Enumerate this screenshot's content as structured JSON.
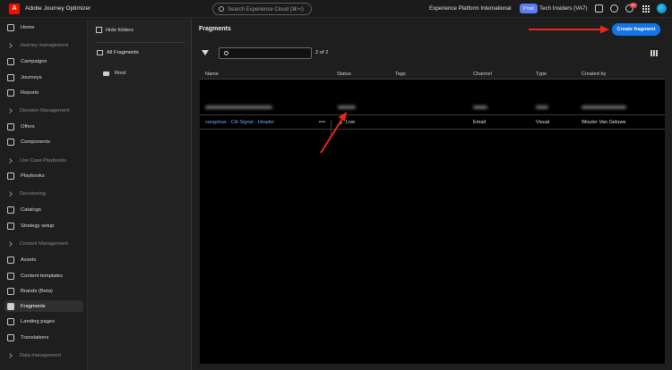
{
  "app": {
    "logo_glyph": "A",
    "title": "Adobe Journey Optimizer",
    "search_placeholder": "Search Experience Cloud (⌘+/)",
    "org_name": "Experience Platform International",
    "sandbox_badge": "Prod",
    "sandbox_name": "Tech Insiders (VA7)",
    "notification_count": "9+",
    "icons": [
      "help-icon",
      "notifications-icon",
      "apps-icon",
      "feedback-icon",
      "avatar"
    ]
  },
  "nav": {
    "home": "Home",
    "sections": {
      "journey": "Journey management",
      "decision": "Decision Management",
      "playbooks": "Use Case Playbooks",
      "decisioning": "Decisioning",
      "content": "Content Management",
      "data": "Data management"
    },
    "items": {
      "campaigns": "Campaigns",
      "journeys": "Journeys",
      "reports": "Reports",
      "offers": "Offers",
      "components": "Components",
      "playbooks": "Playbooks",
      "catalogs": "Catalogs",
      "strategy": "Strategy setup",
      "assets": "Assets",
      "templates": "Content templates",
      "brands": "Brands (Beta)",
      "fragments": "Fragments",
      "landing": "Landing pages",
      "translations": "Translations"
    },
    "active": "Fragments"
  },
  "folders": {
    "hide_label": "Hide folders",
    "all_label": "All Fragments",
    "root_label": "Root"
  },
  "main": {
    "title": "Fragments",
    "create_button": "Create fragment",
    "search_value": "",
    "result_count": "2 of 2",
    "columns": {
      "name": "Name",
      "status": "Status",
      "tags": "Tags",
      "channel": "Channel",
      "type": "Type",
      "created_by": "Created by"
    },
    "rows": [
      {
        "name": "",
        "status": "",
        "tags": "",
        "channel": "",
        "type": "",
        "created_by": "",
        "blurred": true
      },
      {
        "name": "vangeluw - Citi Signal - Header",
        "status": "Live",
        "tags": "",
        "channel": "Email",
        "type": "Visual",
        "created_by": "Wouter Van Geluwe",
        "blurred": false
      }
    ]
  },
  "colors": {
    "accent": "#1473e6",
    "annotation_arrow": "#e8291c",
    "live_status": "#2d9d78",
    "brand": "#eb1000"
  }
}
